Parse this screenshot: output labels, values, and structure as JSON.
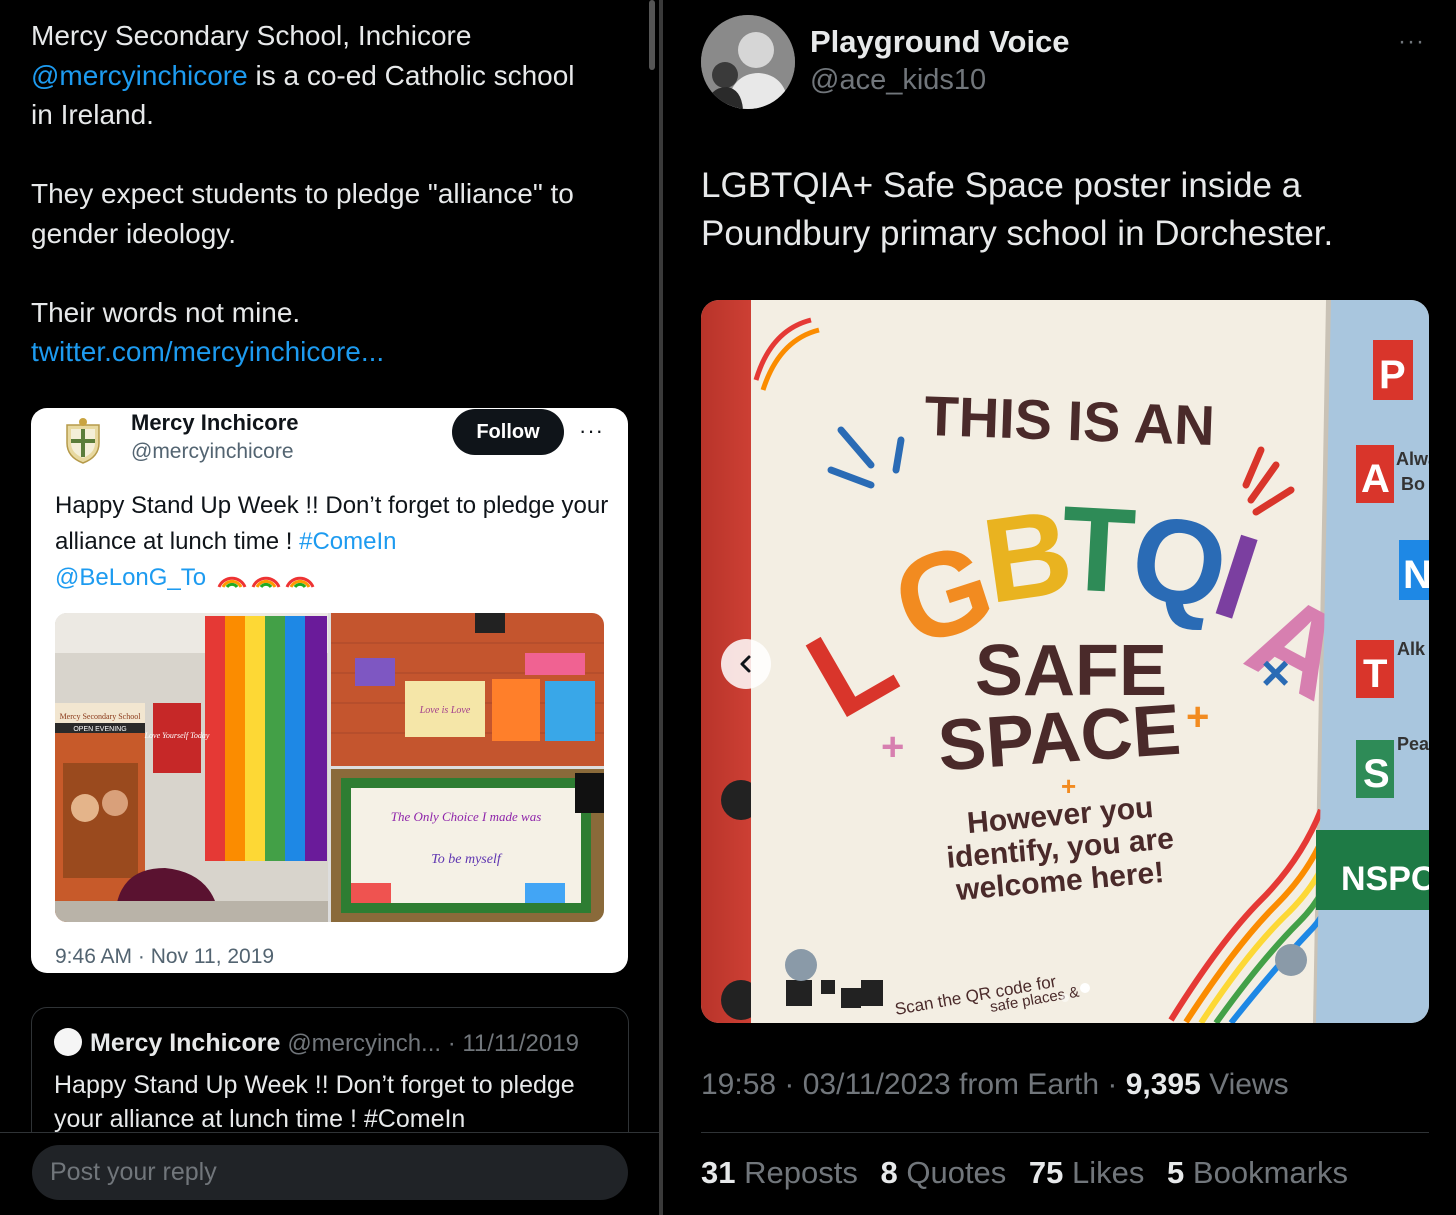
{
  "left_tweet": {
    "line1": "Mercy Secondary School, Inchicore",
    "mention": "@mercyinchicore",
    "line2_rest": " is a co-ed Catholic school",
    "line3": "in Ireland.",
    "para2": "They expect students to pledge \"alliance\" to gender ideology.",
    "para3": "Their words not mine.",
    "link": "twitter.com/mercyinchicore..."
  },
  "embedded_card": {
    "name": "Mercy Inchicore",
    "handle": "@mercyinchicore",
    "follow_label": "Follow",
    "more": "···",
    "text_main": "Happy Stand Up Week !! Don’t forget to pledge your alliance at lunch time ! ",
    "hashtag": "#ComeIn",
    "mention": "@BeLonG_To",
    "timestamp": "9:46 AM · Nov 11, 2019",
    "photo_texts": {
      "banner_title": "Mercy Secondary School",
      "banner_sub": "OPEN EVENING",
      "poster": "Love Yourself Today",
      "love_sign": "Love is Love",
      "board_line1": "The Only Choice I made was",
      "board_line2": "To be myself"
    }
  },
  "quoted_tweet": {
    "name": "Mercy Inchicore",
    "handle_date": "@mercyinch... · 11/11/2019",
    "text": "Happy Stand Up Week !! Don’t forget to pledge your alliance at lunch time ! #ComeIn"
  },
  "reply": {
    "placeholder": "Post your reply"
  },
  "right_tweet": {
    "name": "Playground Voice",
    "handle": "@ace_kids10",
    "more": "···",
    "text": "LGBTQIA+ Safe Space poster inside a Poundbury primary school in Dorchester.",
    "poster": {
      "line1": "THIS IS AN",
      "big": "LGBTQIA",
      "safe": "SAFE",
      "space": "SPACE",
      "welcome1": "However you",
      "welcome2": "identify, you are",
      "welcome3": "welcome here!",
      "qr_text": "Scan the QR code for",
      "qr_text2": "safe places &",
      "side_letters": [
        "P",
        "A",
        "N",
        "T",
        "S"
      ],
      "side_words": [
        "Always",
        "Bo",
        "Alk",
        "Pea"
      ],
      "nspcc": "NSPC"
    },
    "time": "19:58 · 03/11/2023 from Earth · ",
    "views_count": "9,395",
    "views_label": " Views",
    "stats": [
      {
        "n": "31",
        "label": "Reposts"
      },
      {
        "n": "8",
        "label": "Quotes"
      },
      {
        "n": "75",
        "label": "Likes"
      },
      {
        "n": "5",
        "label": "Bookmarks"
      }
    ]
  },
  "colors": {
    "link": "#1d9bf0",
    "background": "#000000",
    "muted": "#71767b",
    "text": "#e7e9ea"
  }
}
